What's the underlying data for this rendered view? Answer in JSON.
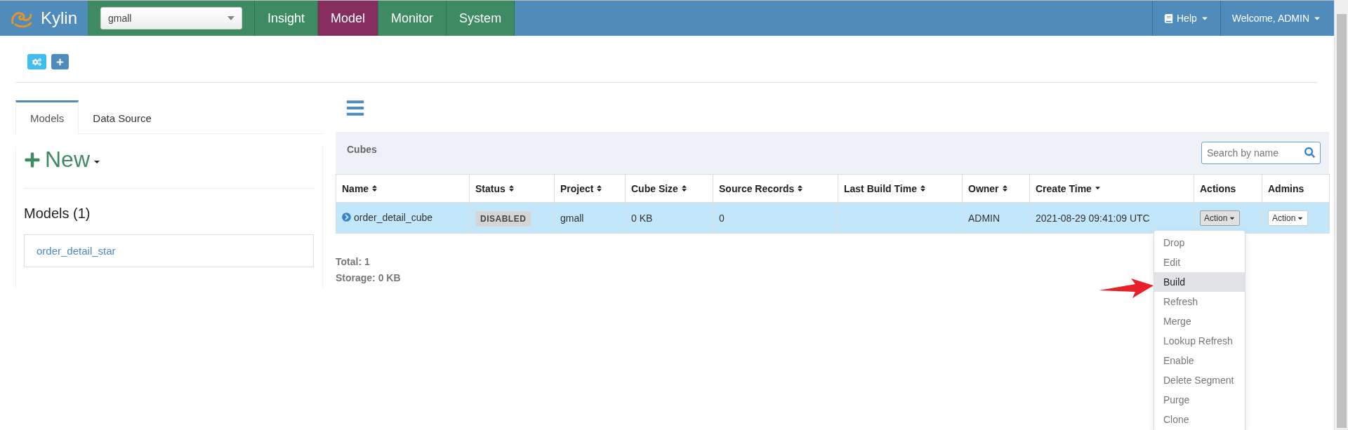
{
  "navbar": {
    "brand": "Kylin",
    "project_select": {
      "value": "gmall"
    },
    "tabs": [
      {
        "label": "Insight",
        "selected": false
      },
      {
        "label": "Model",
        "selected": true
      },
      {
        "label": "Monitor",
        "selected": false
      },
      {
        "label": "System",
        "selected": false
      }
    ],
    "help": "Help",
    "user": "Welcome, ADMIN"
  },
  "sidebar": {
    "tabs": [
      {
        "label": "Models",
        "selected": true
      },
      {
        "label": "Data Source",
        "selected": false
      }
    ],
    "new_button": "New",
    "models_heading": "Models (1)",
    "models": [
      "order_detail_star"
    ]
  },
  "cubes": {
    "title": "Cubes",
    "search": {
      "placeholder": "Search by name"
    },
    "columns": [
      {
        "label": "Name",
        "kind": "sortable"
      },
      {
        "label": "Status",
        "kind": "sortable"
      },
      {
        "label": "Project",
        "kind": "sortable"
      },
      {
        "label": "Cube Size",
        "kind": "sortable"
      },
      {
        "label": "Source Records",
        "kind": "sortable"
      },
      {
        "label": "Last Build Time",
        "kind": "sortable"
      },
      {
        "label": "Owner",
        "kind": "sortable"
      },
      {
        "label": "Create Time",
        "kind": "sorted"
      },
      {
        "label": "Actions",
        "kind": "plain"
      },
      {
        "label": "Admins",
        "kind": "plain"
      }
    ],
    "rows": [
      {
        "selected": true,
        "name": "order_detail_cube",
        "status": "DISABLED",
        "project": "gmall",
        "cube_size": "0 KB",
        "source_records": "0",
        "owner": "ADMIN",
        "create_time": "2021-08-29 09:41:09 UTC",
        "actions": "Action",
        "admins": "Action"
      }
    ],
    "total": "Total: 1",
    "storage": "Storage: 0 KB"
  },
  "action_menu": {
    "items": [
      {
        "label": "Drop",
        "selected": false
      },
      {
        "label": "Edit",
        "selected": false
      },
      {
        "label": "Build",
        "selected": true
      },
      {
        "label": "Refresh",
        "selected": false
      },
      {
        "label": "Merge",
        "selected": false
      },
      {
        "label": "Lookup Refresh",
        "selected": false
      },
      {
        "label": "Enable",
        "selected": false
      },
      {
        "label": "Delete Segment",
        "selected": false
      },
      {
        "label": "Purge",
        "selected": false
      },
      {
        "label": "Clone",
        "selected": false
      }
    ]
  }
}
